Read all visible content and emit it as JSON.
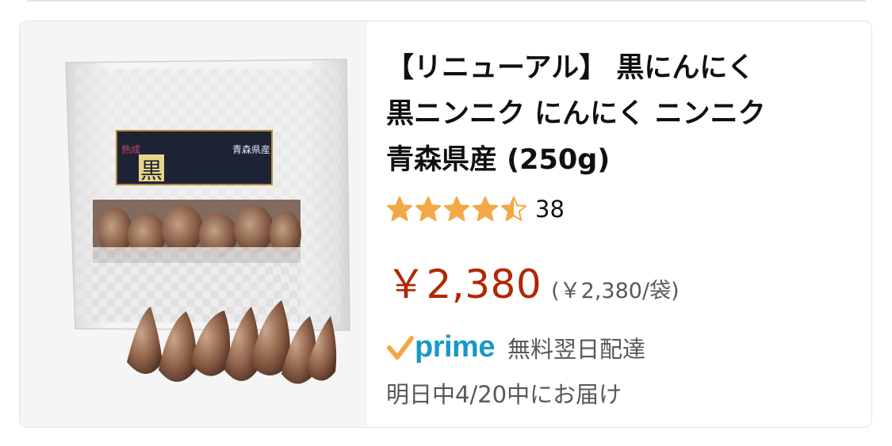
{
  "product": {
    "title_lines": [
      "【リニューアル】 黒にんにく",
      "黒ニンニク にんにく ニンニク",
      "青森県産 (250g)"
    ],
    "image_alt": "黒にんにく 青森県産",
    "package_label": {
      "badge": "熟成",
      "main": "黒にんにく",
      "origin": "青森県産"
    },
    "rating": {
      "value": 4.5,
      "max": 5,
      "count": "38",
      "star_color": "#f3a847"
    },
    "price": "￥2,380",
    "unit_price": "(￥2,380/袋)",
    "price_color": "#b12704",
    "prime": {
      "logo_text": "prime",
      "brand_color": "#1799c7",
      "check_color": "#f3a847",
      "delivery_type": "無料翌日配達",
      "delivery_date": "明日中4/20中にお届け"
    }
  }
}
